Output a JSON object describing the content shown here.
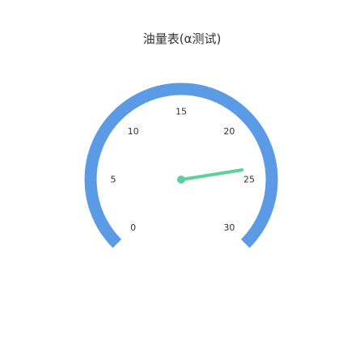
{
  "chart_data": {
    "type": "gauge",
    "title": "油量表(α测试)",
    "min": 0,
    "max": 30,
    "value": 24,
    "ticks": [
      "0",
      "5",
      "10",
      "15",
      "20",
      "25",
      "30"
    ],
    "tick_values": [
      0,
      5,
      10,
      15,
      20,
      25,
      30
    ],
    "colors": {
      "axis": "#5b9be6",
      "pointer": "#5ad196",
      "text": "#333333"
    }
  }
}
